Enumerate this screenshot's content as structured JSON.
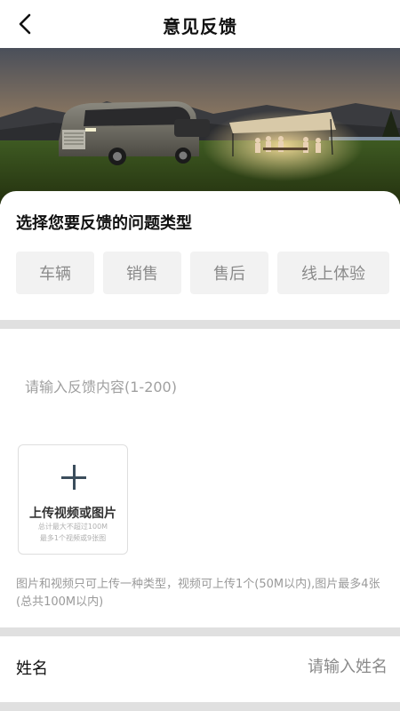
{
  "header": {
    "title": "意见反馈",
    "back_icon": "chevron-left-icon"
  },
  "banner": {
    "image_description_icon": "photo-icon"
  },
  "category": {
    "heading": "选择您要反馈的问题类型",
    "options": [
      {
        "label": "车辆"
      },
      {
        "label": "销售"
      },
      {
        "label": "售后"
      },
      {
        "label": "线上体验"
      }
    ]
  },
  "feedback": {
    "placeholder": "请输入反馈内容(1-200)",
    "value": ""
  },
  "upload": {
    "label": "上传视频或图片",
    "sub1": "总计最大不超过100M",
    "sub2": "最多1个视频或9张图",
    "icon": "plus-icon"
  },
  "upload_note": "图片和视频只可上传一种类型，视频可上传1个(50M以内),图片最多4张(总共100M以内)",
  "name_field": {
    "label": "姓名",
    "placeholder": "请输入姓名",
    "value": ""
  },
  "colors": {
    "chip_bg": "#f2f2f2",
    "chip_text": "#8a8a8a",
    "separator": "#e0e0e0",
    "title_text": "#111111"
  }
}
